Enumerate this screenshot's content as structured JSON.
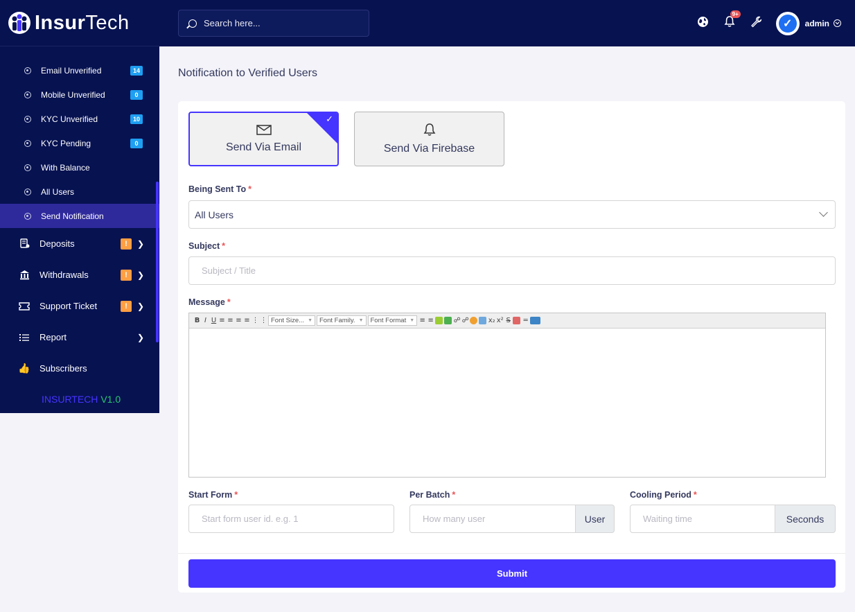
{
  "app": {
    "logo_main": "Insur",
    "logo_accent": "Tech"
  },
  "sidebar": {
    "sub_items": [
      {
        "label": "Email Unverified",
        "badge": "14"
      },
      {
        "label": "Mobile Unverified",
        "badge": "0"
      },
      {
        "label": "KYC Unverified",
        "badge": "10"
      },
      {
        "label": "KYC Pending",
        "badge": "0"
      },
      {
        "label": "With Balance",
        "badge": ""
      },
      {
        "label": "All Users",
        "badge": ""
      },
      {
        "label": "Send Notification",
        "badge": "",
        "active": true
      }
    ],
    "main_items": [
      {
        "label": "Deposits",
        "icon": "deposit-icon",
        "warn": "!"
      },
      {
        "label": "Withdrawals",
        "icon": "bank-icon",
        "warn": "!"
      },
      {
        "label": "Support Ticket",
        "icon": "ticket-icon",
        "warn": "!"
      },
      {
        "label": "Report",
        "icon": "list-icon",
        "warn": ""
      },
      {
        "label": "Subscribers",
        "icon": "thumbs-up-icon",
        "warn": ""
      }
    ],
    "version_name": "INSURTECH",
    "version_number": "V1.0"
  },
  "topbar": {
    "search_placeholder": "Search here...",
    "notification_count": "9+",
    "username": "admin"
  },
  "page": {
    "title": "Notification to Verified Users",
    "methods": {
      "email": "Send Via Email",
      "firebase": "Send Via Firebase"
    },
    "being_sent_to_label": "Being Sent To",
    "being_sent_to_value": "All Users",
    "subject_label": "Subject",
    "subject_placeholder": "Subject / Title",
    "message_label": "Message",
    "editor": {
      "font_size": "Font Size...",
      "font_family": "Font Family.",
      "font_format": "Font Format"
    },
    "start_form_label": "Start Form",
    "start_form_placeholder": "Start form user id. e.g. 1",
    "per_batch_label": "Per Batch",
    "per_batch_placeholder": "How many user",
    "per_batch_addon": "User",
    "cooling_label": "Cooling Period",
    "cooling_placeholder": "Waiting time",
    "cooling_addon": "Seconds",
    "submit": "Submit",
    "required_mark": "*"
  },
  "colors": {
    "sidebar": "#071251",
    "accent": "#4634ff",
    "badge": "#1e9ff2",
    "warn": "#ff9f43",
    "required": "#ea5455"
  }
}
